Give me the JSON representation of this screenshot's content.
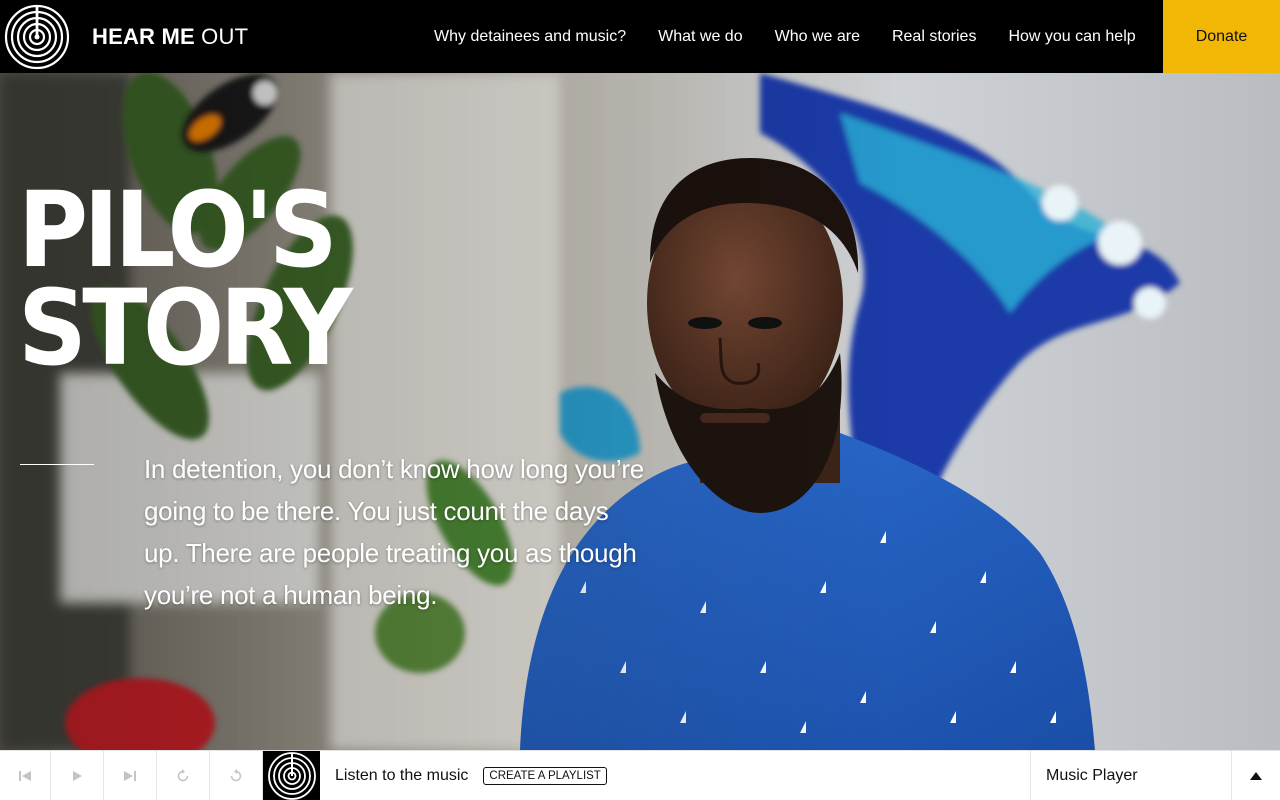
{
  "header": {
    "brand_bold": "HEAR ME",
    "brand_light": "OUT",
    "nav": [
      {
        "label": "Why detainees and music?"
      },
      {
        "label": "What we do"
      },
      {
        "label": "Who we are"
      },
      {
        "label": "Real stories"
      },
      {
        "label": "How you can help"
      }
    ],
    "donate_label": "Donate",
    "accent_color": "#f2b705"
  },
  "hero": {
    "title_line1": "PILO'S",
    "title_line2": "STORY",
    "quote": "In detention, you don’t know how long you’re going to be there. You just count the days up. There are people treating you as though you’re not a human being."
  },
  "player": {
    "controls": [
      {
        "icon": "skip-previous-icon"
      },
      {
        "icon": "play-icon"
      },
      {
        "icon": "skip-next-icon"
      },
      {
        "icon": "rewind-icon"
      },
      {
        "icon": "forward-icon"
      }
    ],
    "listen_label": "Listen to the music",
    "playlist_button": "Create a playlist",
    "panel_label": "Music Player",
    "toggle_icon": "chevron-up-icon"
  }
}
